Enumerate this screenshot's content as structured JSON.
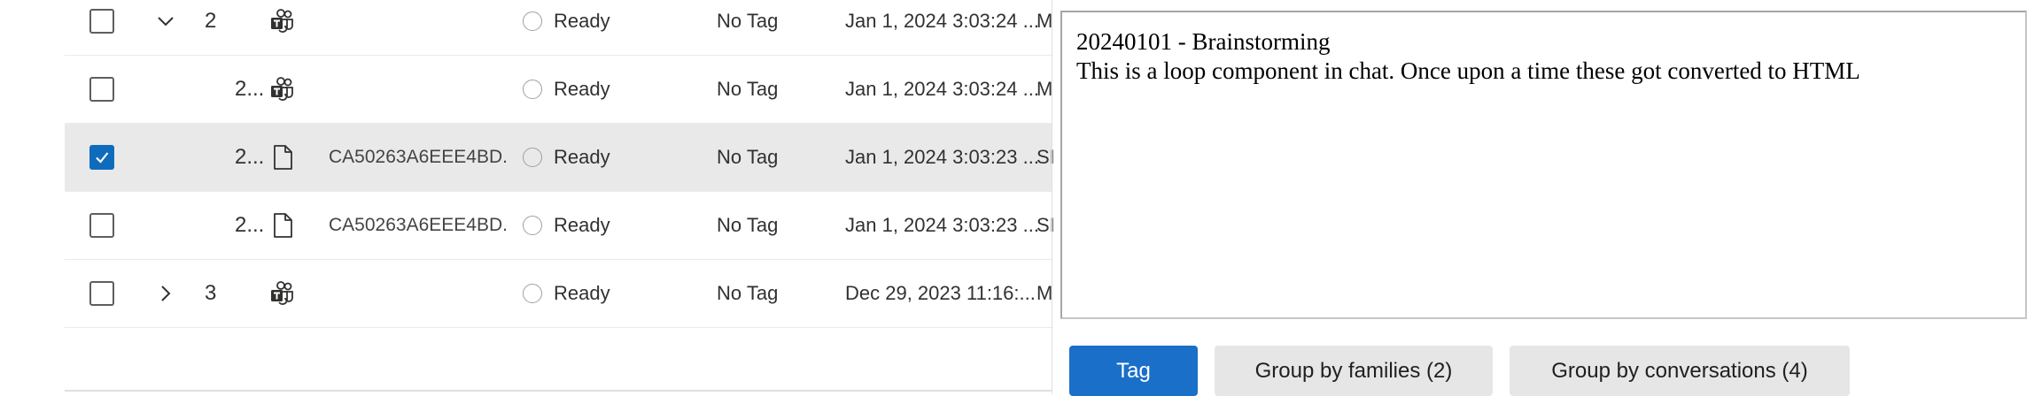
{
  "rows": [
    {
      "count": "2",
      "expander": "expanded",
      "type": "teams-icon",
      "filename": "",
      "status": "Ready",
      "tag": "No Tag",
      "date": "Jan 1, 2024 3:03:24 ...",
      "clip": "M",
      "checked": false
    },
    {
      "count": "2...",
      "expander": "none",
      "type": "teams-icon",
      "filename": "",
      "status": "Ready",
      "tag": "No Tag",
      "date": "Jan 1, 2024 3:03:24 ...",
      "clip": "M",
      "checked": false
    },
    {
      "count": "2...",
      "expander": "none",
      "type": "document-icon",
      "filename": "CA50263A6EEE4BD...",
      "status": "Ready",
      "tag": "No Tag",
      "date": "Jan 1, 2024 3:03:23 ...",
      "clip": "SI",
      "checked": true
    },
    {
      "count": "2...",
      "expander": "none",
      "type": "document-icon",
      "filename": "CA50263A6EEE4BD...",
      "status": "Ready",
      "tag": "No Tag",
      "date": "Jan 1, 2024 3:03:23 ...",
      "clip": "SI",
      "checked": false
    },
    {
      "count": "3",
      "expander": "collapsed",
      "type": "teams-icon",
      "filename": "",
      "status": "Ready",
      "tag": "No Tag",
      "date": "Dec 29, 2023 11:16:...",
      "clip": "M",
      "checked": false
    }
  ],
  "preview": {
    "title": "20240101 - Brainstorming",
    "body": "This is a loop component in chat. Once upon a time these got converted to HTML"
  },
  "actions": {
    "tag_label": "Tag",
    "group_families_label": "Group by families (2)",
    "group_conversations_label": "Group by conversations (4)"
  },
  "colors": {
    "accent": "#1a6fc9",
    "checkbox_checked": "#0f6cbd",
    "selected_row": "#e9e9e9"
  }
}
